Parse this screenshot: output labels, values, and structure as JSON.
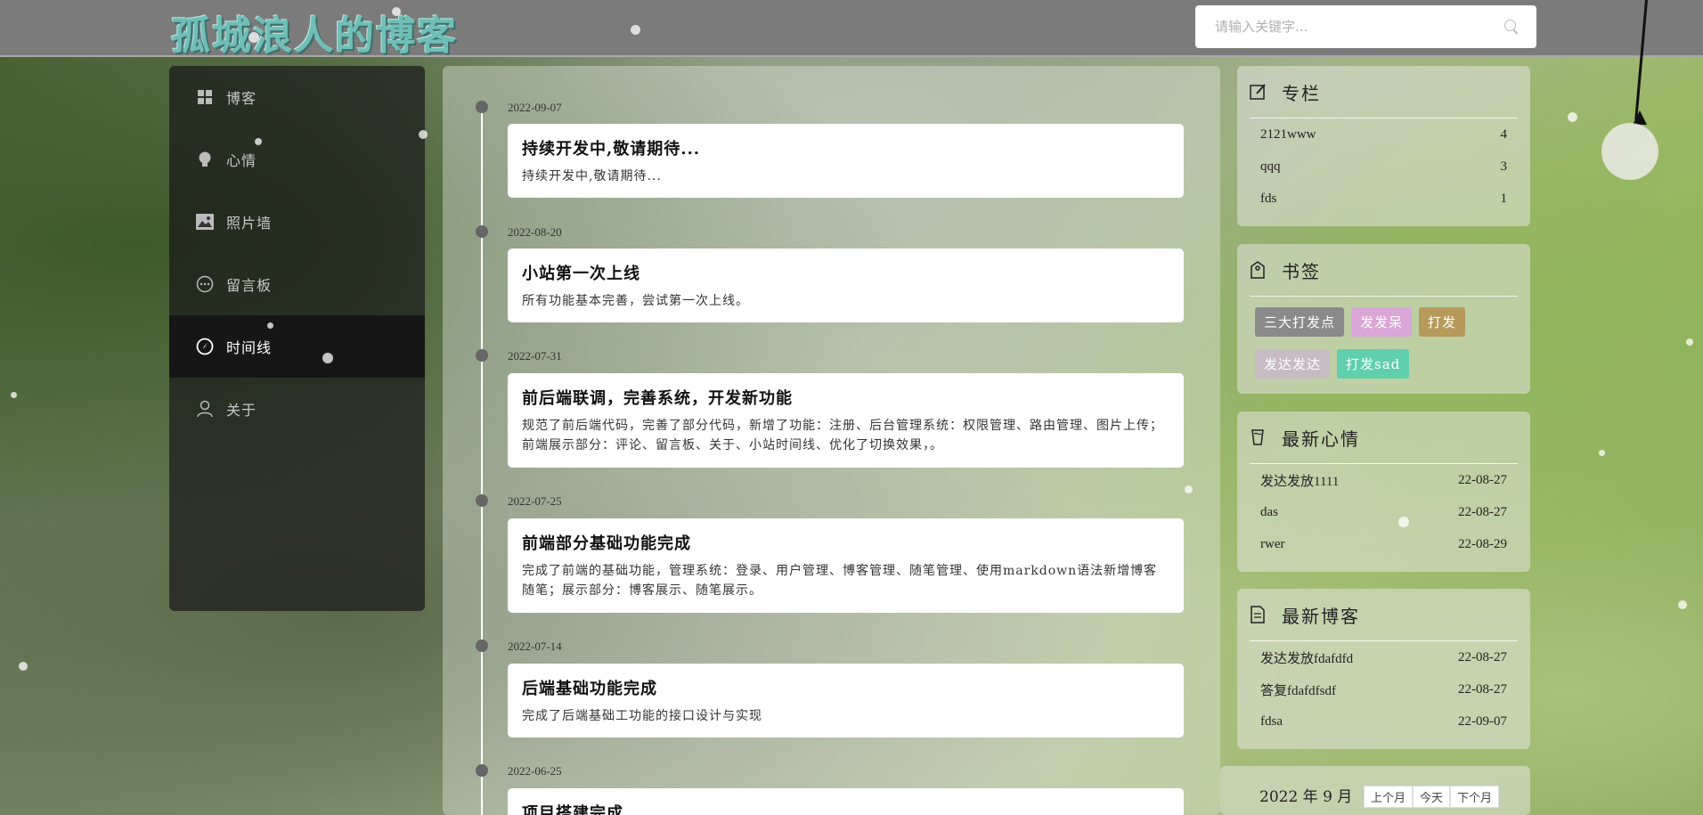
{
  "header": {
    "logo": "孤城浪人的博客",
    "search_placeholder": "请输入关键字..."
  },
  "sidebar": {
    "items": [
      {
        "label": "博客",
        "icon": "grid-icon"
      },
      {
        "label": "心情",
        "icon": "bulb-icon"
      },
      {
        "label": "照片墙",
        "icon": "image-icon"
      },
      {
        "label": "留言板",
        "icon": "chat-icon"
      },
      {
        "label": "时间线",
        "icon": "compass-icon",
        "active": true
      },
      {
        "label": "关于",
        "icon": "user-icon"
      }
    ]
  },
  "timeline": [
    {
      "date": "2022-09-07",
      "title": "持续开发中,敬请期待...",
      "desc": "持续开发中,敬请期待..."
    },
    {
      "date": "2022-08-20",
      "title": "小站第一次上线",
      "desc": "所有功能基本完善，尝试第一次上线。"
    },
    {
      "date": "2022-07-31",
      "title": "前后端联调，完善系统，开发新功能",
      "desc": "规范了前后端代码，完善了部分代码，新增了功能：注册、后台管理系统：权限管理、路由管理、图片上传；前端展示部分：评论、留言板、关于、小站时间线、优化了切换效果，。"
    },
    {
      "date": "2022-07-25",
      "title": "前端部分基础功能完成",
      "desc": "完成了前端的基础功能，管理系统：登录、用户管理、博客管理、随笔管理、使用markdown语法新增博客随笔；展示部分：博客展示、随笔展示。"
    },
    {
      "date": "2022-07-14",
      "title": "后端基础功能完成",
      "desc": "完成了后端基础工功能的接口设计与实现"
    },
    {
      "date": "2022-06-25",
      "title": "项目搭建完成",
      "desc": ""
    }
  ],
  "columns": {
    "title": "专栏",
    "items": [
      {
        "name": "2121www",
        "count": "4"
      },
      {
        "name": "qqq",
        "count": "3"
      },
      {
        "name": "fds",
        "count": "1"
      }
    ]
  },
  "bookmarks": {
    "title": "书签",
    "tags": [
      {
        "label": "三大打发点",
        "color": "#8a8a8a"
      },
      {
        "label": "发发呆",
        "color": "#d9a6d6"
      },
      {
        "label": "打发",
        "color": "#b59a5a"
      },
      {
        "label": "发达发达",
        "color": "#c7bcc4"
      },
      {
        "label": "打发sad",
        "color": "#5fcfae"
      }
    ]
  },
  "moods": {
    "title": "最新心情",
    "items": [
      {
        "name": "发达发放1111",
        "date": "22-08-27"
      },
      {
        "name": "das",
        "date": "22-08-27"
      },
      {
        "name": "rwer",
        "date": "22-08-29"
      }
    ]
  },
  "blogs": {
    "title": "最新博客",
    "items": [
      {
        "name": "发达发放fdafdfd",
        "date": "22-08-27"
      },
      {
        "name": "答复fdafdfsdf",
        "date": "22-08-27"
      },
      {
        "name": "fdsa",
        "date": "22-09-07"
      }
    ]
  },
  "calendar": {
    "title": "2022 年 9 月",
    "prev": "上个月",
    "today": "今天",
    "next": "下个月"
  }
}
